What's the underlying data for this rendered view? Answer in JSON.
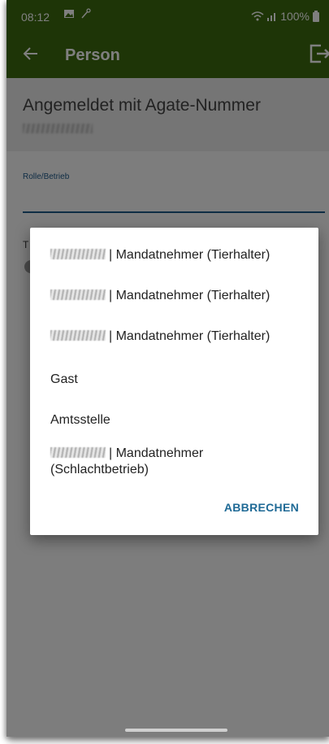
{
  "status_bar": {
    "time": "08:12",
    "battery": "100%"
  },
  "app_bar": {
    "title": "Person",
    "back_icon": "arrow-left-icon",
    "logout_icon": "logout-icon"
  },
  "header": {
    "login_label": "Angemeldet mit Agate-Nummer"
  },
  "form": {
    "rolle_label": "Rolle/Betrieb",
    "peek_label": "T"
  },
  "dialog": {
    "options": [
      {
        "label": "| Mandatnehmer (Tierhalter)"
      },
      {
        "label": "| Mandatnehmer (Tierhalter)"
      },
      {
        "label": "| Mandatnehmer (Tierhalter)"
      },
      {
        "label": "Gast"
      },
      {
        "label": "Amtsstelle"
      },
      {
        "label": "| Mandatnehmer",
        "label_line2": "(Schlachtbetrieb)"
      }
    ],
    "cancel_label": "ABBRECHEN"
  },
  "colors": {
    "app_bar": "#3d6b0e",
    "accent": "#1f6a96"
  }
}
